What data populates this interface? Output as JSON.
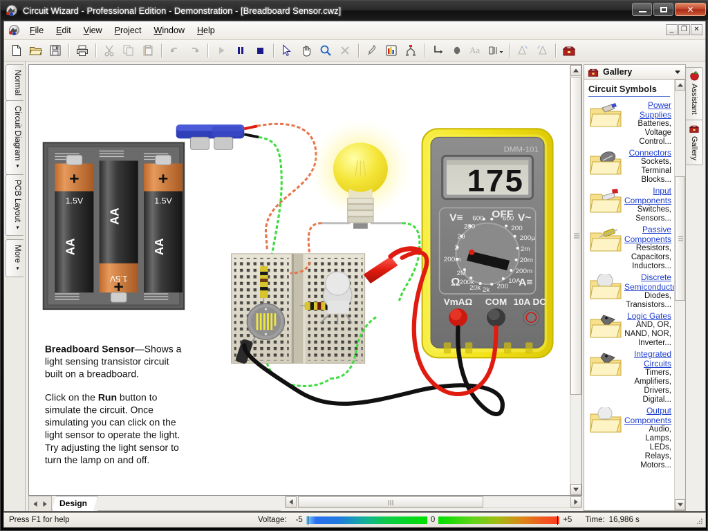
{
  "window": {
    "title": "Circuit Wizard - Professional Edition - Demonstration - [Breadboard Sensor.cwz]",
    "minimize_label": "–",
    "restore_label": "□",
    "close_label": "✕"
  },
  "mdi": {
    "minimize_label": "_",
    "restore_label": "❐",
    "close_label": "✕"
  },
  "menu": {
    "items": [
      {
        "label": "File",
        "accel": "F"
      },
      {
        "label": "Edit",
        "accel": "E"
      },
      {
        "label": "View",
        "accel": "V"
      },
      {
        "label": "Project",
        "accel": "P"
      },
      {
        "label": "Window",
        "accel": "W"
      },
      {
        "label": "Help",
        "accel": "H"
      }
    ]
  },
  "toolbar": {
    "buttons": [
      {
        "name": "new-file-button",
        "icon": "new-document-icon",
        "tooltip": "New",
        "enabled": true
      },
      {
        "name": "open-file-button",
        "icon": "open-folder-icon",
        "tooltip": "Open",
        "enabled": true
      },
      {
        "name": "save-file-button",
        "icon": "floppy-disk-icon",
        "tooltip": "Save",
        "enabled": true
      },
      {
        "name": "print-button",
        "icon": "printer-icon",
        "tooltip": "Print",
        "enabled": true
      },
      {
        "name": "cut-button",
        "icon": "scissors-icon",
        "tooltip": "Cut",
        "enabled": false
      },
      {
        "name": "copy-button",
        "icon": "copy-icon",
        "tooltip": "Copy",
        "enabled": false
      },
      {
        "name": "paste-button",
        "icon": "clipboard-icon",
        "tooltip": "Paste",
        "enabled": false
      },
      {
        "name": "undo-button",
        "icon": "undo-arrow-icon",
        "tooltip": "Undo",
        "enabled": false
      },
      {
        "name": "redo-button",
        "icon": "redo-arrow-icon",
        "tooltip": "Redo",
        "enabled": false
      },
      {
        "name": "run-button",
        "icon": "play-triangle-icon",
        "tooltip": "Run",
        "enabled": false
      },
      {
        "name": "pause-button",
        "icon": "pause-bars-icon",
        "tooltip": "Pause",
        "enabled": true
      },
      {
        "name": "stop-button",
        "icon": "stop-square-icon",
        "tooltip": "Stop",
        "enabled": true
      },
      {
        "name": "select-tool-button",
        "icon": "arrow-cursor-icon",
        "tooltip": "Select",
        "enabled": true
      },
      {
        "name": "pan-tool-button",
        "icon": "hand-icon",
        "tooltip": "Pan",
        "enabled": true
      },
      {
        "name": "zoom-tool-button",
        "icon": "magnifier-icon",
        "tooltip": "Zoom",
        "enabled": true
      },
      {
        "name": "delete-button",
        "icon": "cross-icon",
        "tooltip": "Delete",
        "enabled": false
      },
      {
        "name": "probe-tool-button",
        "icon": "probe-icon",
        "tooltip": "Probe",
        "enabled": true
      },
      {
        "name": "graph-button",
        "icon": "bar-chart-icon",
        "tooltip": "Graph",
        "enabled": true
      },
      {
        "name": "netlist-button",
        "icon": "network-icon",
        "tooltip": "Netlist",
        "enabled": true
      },
      {
        "name": "wire-tool-button",
        "icon": "wire-corner-icon",
        "tooltip": "Wire",
        "enabled": true
      },
      {
        "name": "node-tool-button",
        "icon": "node-dot-icon",
        "tooltip": "Node",
        "enabled": true
      },
      {
        "name": "text-tool-button",
        "icon": "text-aa-icon",
        "tooltip": "Text",
        "enabled": true
      },
      {
        "name": "align-button",
        "icon": "align-icon",
        "tooltip": "Align",
        "enabled": true
      },
      {
        "name": "flip-h-button",
        "icon": "flip-horizontal-icon",
        "tooltip": "Flip Horizontal",
        "enabled": false
      },
      {
        "name": "flip-v-button",
        "icon": "flip-vertical-icon",
        "tooltip": "Flip Vertical",
        "enabled": false
      },
      {
        "name": "gallery-button",
        "icon": "toolbox-icon",
        "tooltip": "Gallery",
        "enabled": true
      }
    ]
  },
  "left_tabs": [
    {
      "label": "Normal",
      "caret": false,
      "selected": false
    },
    {
      "label": "Circuit Diagram",
      "caret": true,
      "selected": true
    },
    {
      "label": "PCB Layout",
      "caret": true,
      "selected": false
    },
    {
      "label": "More",
      "caret": true,
      "selected": false
    }
  ],
  "right_tabs": [
    {
      "label": "Assistant",
      "icon": "apple-icon"
    },
    {
      "label": "Gallery",
      "icon": "toolbox-icon"
    }
  ],
  "document": {
    "sheet_tab": "Design",
    "prev_arrow": "◀",
    "next_arrow": "▶"
  },
  "circuit": {
    "description": {
      "title": "Breadboard Sensor",
      "dash": "—",
      "lead": "Shows a light sensing transistor circuit built on a breadboard.",
      "para2_before": "Click on the ",
      "para2_bold": "Run",
      "para2_after": " button to simulate the circuit. Once simulating you can click on the light sensor to operate the light. Try adjusting the light sensor to turn the lamp on and off."
    },
    "battery_pack": {
      "cells": [
        {
          "label": "AA",
          "voltage": "1.5V",
          "polarity": "+"
        },
        {
          "label": "AA",
          "voltage": "1.5V",
          "polarity": "+"
        },
        {
          "label": "AA",
          "voltage": "1.5V",
          "polarity": "+"
        }
      ]
    },
    "multimeter": {
      "model": "DMM-101",
      "reading": "175",
      "off_label": "OFF",
      "left_mode": "V═",
      "right_mode": "V~",
      "ohm_symbol": "Ω",
      "amp_label": "A═",
      "left_ranges": [
        "600",
        "200",
        "20",
        "2",
        "200m"
      ],
      "right_ranges": [
        "600",
        "200",
        "200µ",
        "2m",
        "20m",
        "200m",
        "10A"
      ],
      "bottom_ranges": [
        "2M",
        "200k",
        "20k",
        "2k",
        "200"
      ],
      "jacks": [
        "VmAΩ",
        "COM",
        "10A DC"
      ]
    }
  },
  "gallery": {
    "header": "Gallery",
    "section_title": "Circuit Symbols",
    "items": [
      {
        "icon": "folder-power-icon",
        "link": "Power Supplies",
        "desc": "Batteries, Voltage Control..."
      },
      {
        "icon": "folder-connector-icon",
        "link": "Connectors",
        "desc": "Sockets, Terminal Blocks..."
      },
      {
        "icon": "folder-input-icon",
        "link": "Input Components",
        "desc": "Switches, Sensors..."
      },
      {
        "icon": "folder-passive-icon",
        "link": "Passive Components",
        "desc": "Resistors, Capacitors, Inductors..."
      },
      {
        "icon": "folder-semiconductor-icon",
        "link": "Discrete Semiconductor",
        "desc": "Diodes, Transistors..."
      },
      {
        "icon": "folder-logic-icon",
        "link": "Logic Gates",
        "desc": "AND, OR, NAND, NOR, Inverter..."
      },
      {
        "icon": "folder-ic-icon",
        "link": "Integrated Circuits",
        "desc": "Timers, Amplifiers, Drivers, Digital..."
      },
      {
        "icon": "folder-output-icon",
        "link": "Output Components",
        "desc": "Audio, Lamps, LEDs, Relays, Motors..."
      }
    ]
  },
  "status": {
    "help_text": "Press F1 for help",
    "voltage_label": "Voltage:",
    "voltage_min": "-5",
    "voltage_mid": "0",
    "voltage_max": "+5",
    "time_label": "Time:",
    "time_value": "16,986 s"
  },
  "colors": {
    "accent_link": "#1f3fcf",
    "meter_body": "#f5e318",
    "lamp_glow": "#fff27a",
    "wire_green": "#3ddc3d",
    "wire_red": "#e02020",
    "status_green": "#00e000"
  }
}
